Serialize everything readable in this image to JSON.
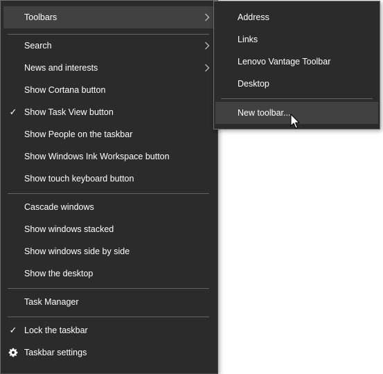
{
  "main_menu": {
    "toolbars": "Toolbars",
    "search": "Search",
    "news_and_interests": "News and interests",
    "show_cortana": "Show Cortana button",
    "show_task_view": "Show Task View button",
    "show_people": "Show People on the taskbar",
    "show_ink_workspace": "Show Windows Ink Workspace button",
    "show_touch_keyboard": "Show touch keyboard button",
    "cascade": "Cascade windows",
    "stacked": "Show windows stacked",
    "side_by_side": "Show windows side by side",
    "show_desktop": "Show the desktop",
    "task_manager": "Task Manager",
    "lock_taskbar": "Lock the taskbar",
    "taskbar_settings": "Taskbar settings",
    "check_mark": "✓",
    "checked": [
      "show_task_view",
      "lock_taskbar"
    ]
  },
  "toolbars_submenu": {
    "address": "Address",
    "links": "Links",
    "lenovo": "Lenovo Vantage Toolbar",
    "desktop": "Desktop",
    "new_toolbar": "New toolbar..."
  },
  "icons": {
    "chevron": "chevron-right-icon",
    "check": "checkmark-icon",
    "settings": "gear-icon",
    "pointer": "mouse-pointer-icon"
  },
  "colors": {
    "menu_bg": "#2b2b2b",
    "hover_bg": "#414141",
    "text": "#ffffff",
    "separator": "#646464"
  }
}
